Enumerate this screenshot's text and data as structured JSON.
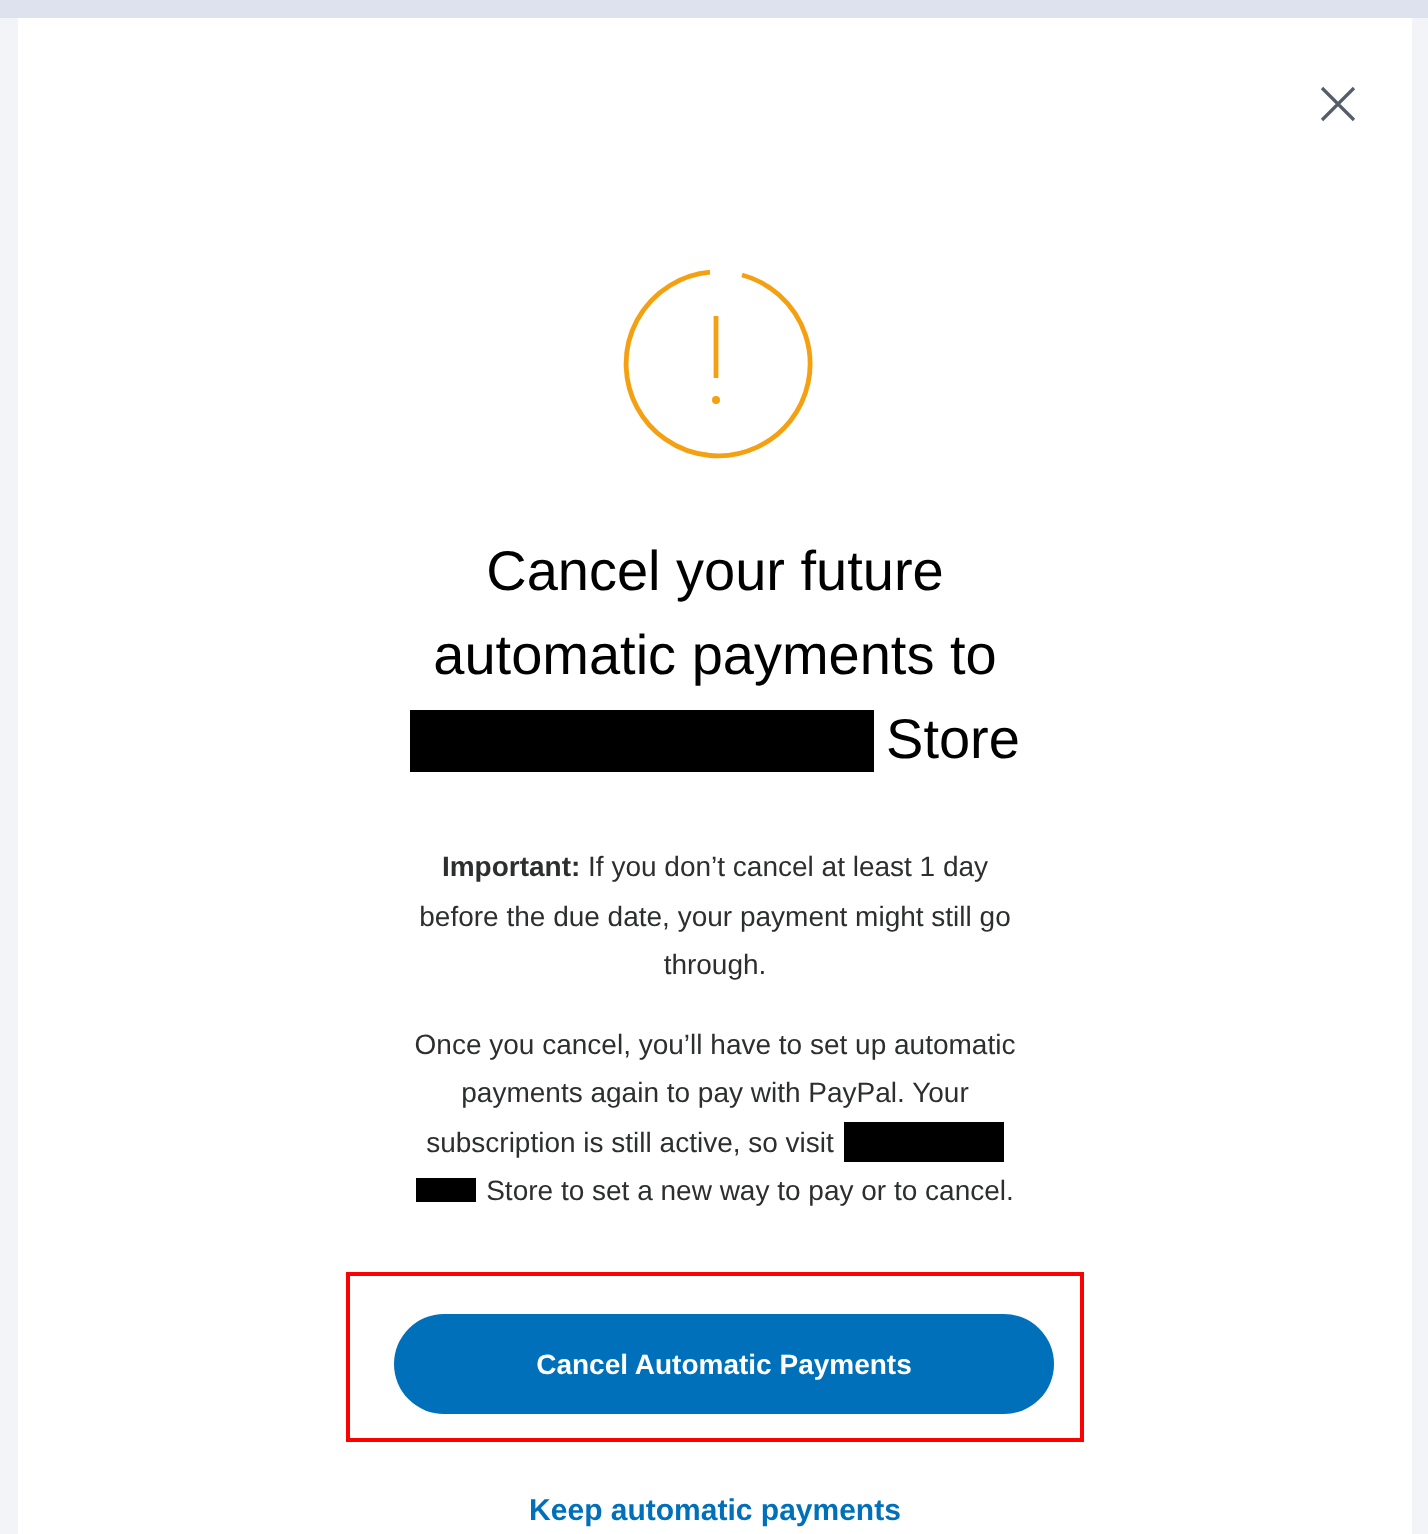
{
  "dialog": {
    "title_lines": [
      "Cancel your future",
      "automatic payments to"
    ],
    "title_end": "Store",
    "notice": "**Important:** If you don’t cancel at least 1 day before the due date, your payment might still go through.",
    "info_lines": [
      "Once you cancel, you’ll have to set up automatic",
      "payments again to pay with PayPal. Your",
      "subscription is still active, so visit"
    ],
    "info_end": "Store to set a new way to pay or to cancel.",
    "primary_button": {
      "label": "Cancel Automatic Payments",
      "highlighted": true
    },
    "link": "Keep automatic payments"
  }
}
